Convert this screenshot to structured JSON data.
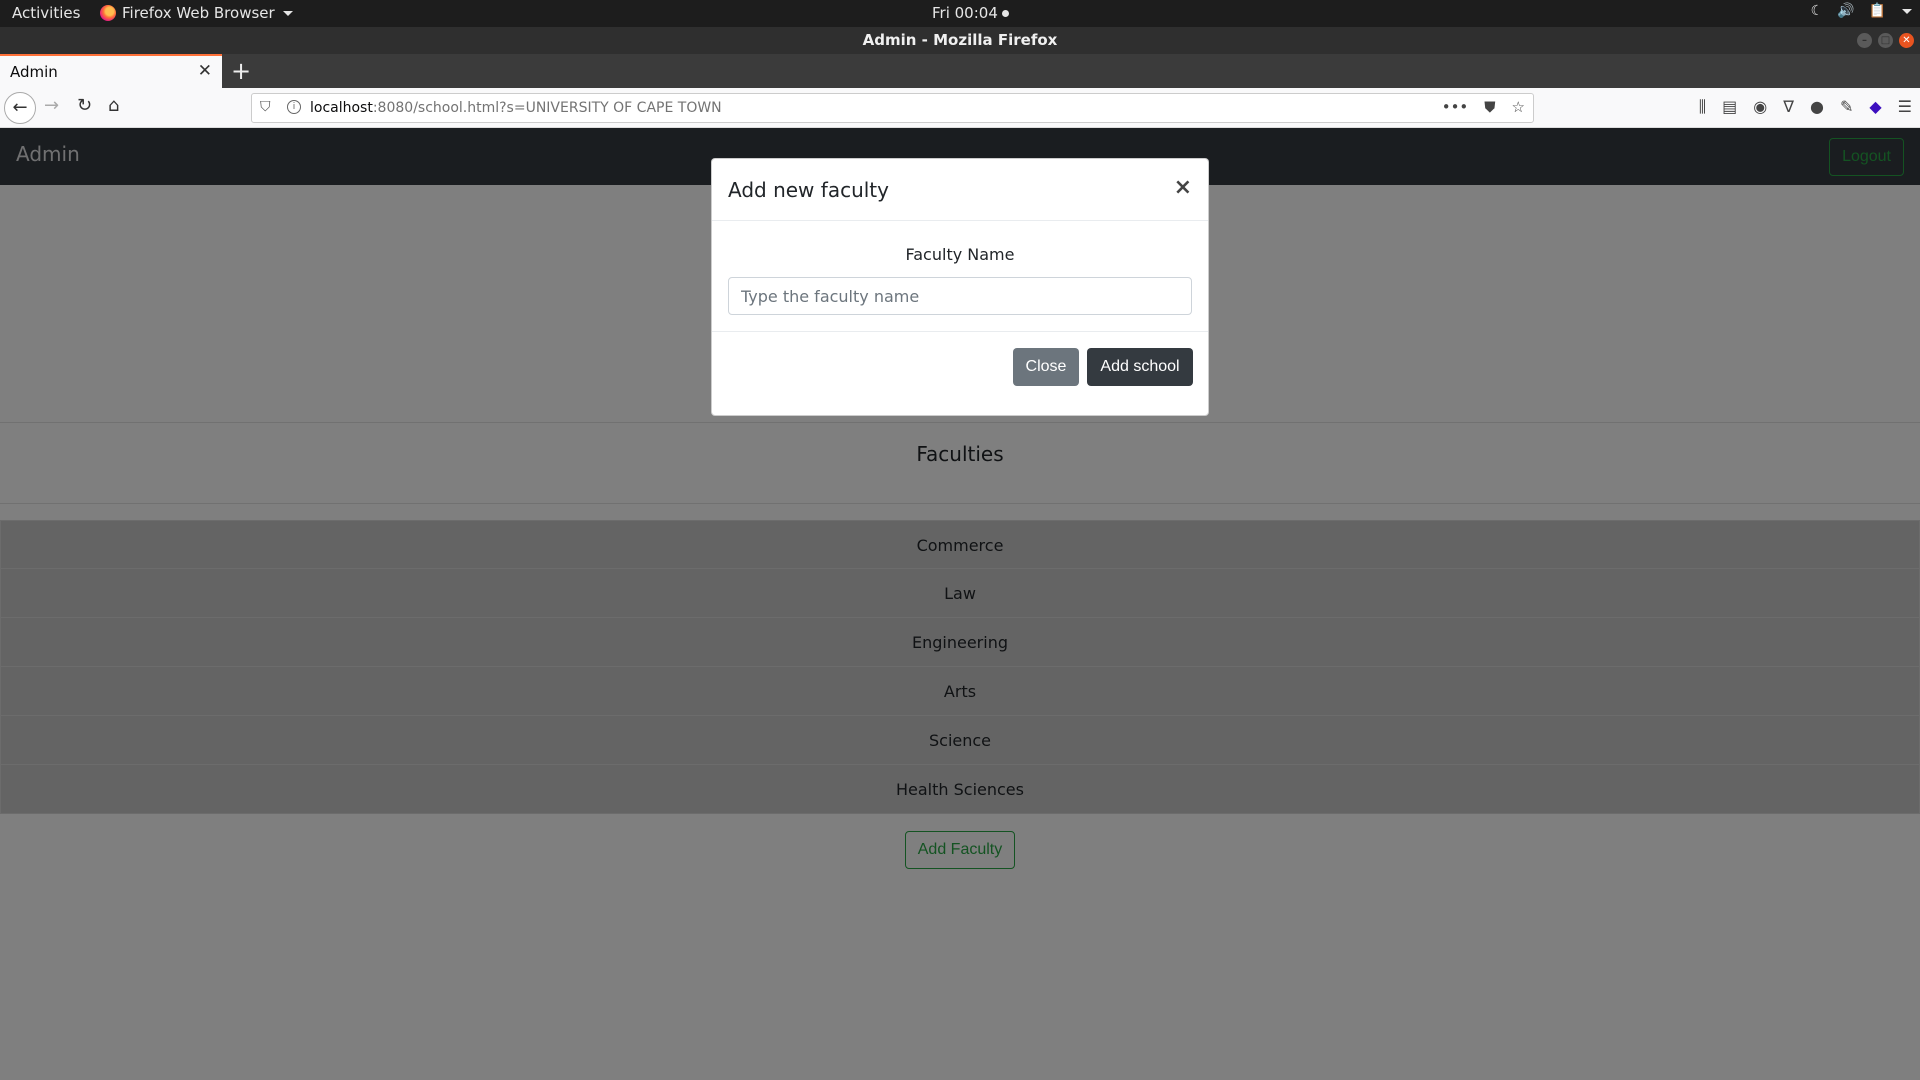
{
  "os_bar": {
    "activities": "Activities",
    "app_name": "Firefox Web Browser",
    "clock": "Fri 00:04"
  },
  "window": {
    "title": "Admin - Mozilla Firefox"
  },
  "browser": {
    "tab_title": "Admin",
    "url_host": "localhost",
    "url_rest": ":8080/school.html?s=UNIVERSITY OF CAPE TOWN"
  },
  "site": {
    "brand": "Admin",
    "logout_label": "Logout",
    "faculties_heading": "Faculties",
    "faculties": [
      "Commerce",
      "Law",
      "Engineering",
      "Arts",
      "Science",
      "Health Sciences"
    ],
    "add_faculty_label": "Add Faculty"
  },
  "modal": {
    "title": "Add new faculty",
    "close_glyph": "×",
    "field_label": "Faculty Name",
    "field_placeholder": "Type the faculty name",
    "field_value": "",
    "close_label": "Close",
    "submit_label": "Add school"
  },
  "colors": {
    "navbar_bg": "#343a40",
    "success": "#28a745",
    "secondary_btn": "#6c757d",
    "dark_btn": "#343a40",
    "tab_accent": "#ff7139"
  }
}
